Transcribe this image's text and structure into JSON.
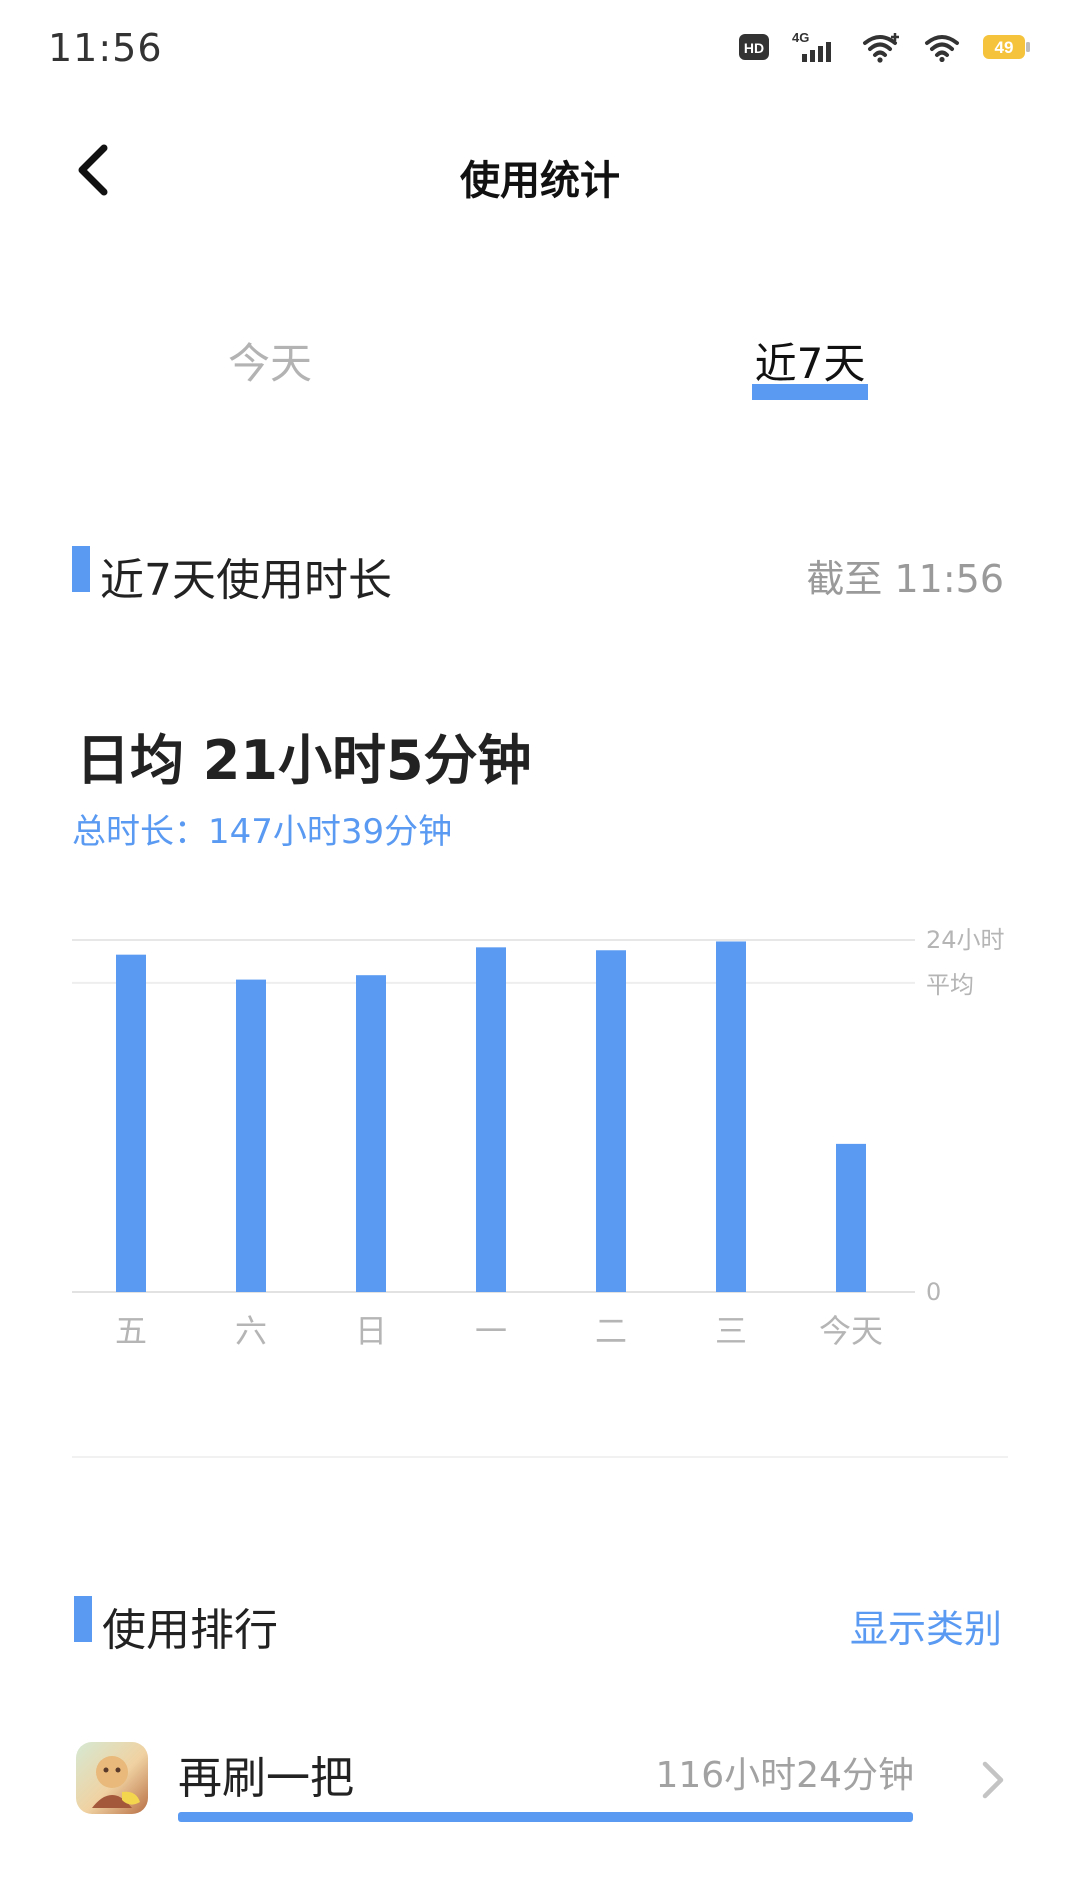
{
  "status_bar": {
    "time": "11:56",
    "hd": "HD",
    "network": "4G",
    "battery": "49"
  },
  "header": {
    "title": "使用统计"
  },
  "tabs": [
    {
      "label": "今天",
      "active": false
    },
    {
      "label": "近7天",
      "active": true
    }
  ],
  "usage_section": {
    "title": "近7天使用时长",
    "as_of": "截至 11:56",
    "daily_average": "日均 21小时5分钟",
    "total": "总时长：147小时39分钟"
  },
  "chart_data": {
    "type": "bar",
    "categories": [
      "五",
      "六",
      "日",
      "一",
      "二",
      "三",
      "今天"
    ],
    "values": [
      23.0,
      21.3,
      21.6,
      23.5,
      23.3,
      23.9,
      10.1
    ],
    "unit": "小时",
    "ylim": [
      0,
      24
    ],
    "max_label": "24小时",
    "avg_label": "平均",
    "average": 21.08,
    "zero_label": "0",
    "bar_color": "#5a9af2"
  },
  "ranking_section": {
    "title": "使用排行",
    "toggle_label": "显示类别",
    "items": [
      {
        "name": "再刷一把",
        "time": "116小时24分钟",
        "hours": 116.4
      }
    ]
  },
  "colors": {
    "accent": "#5a9af2",
    "text_primary": "#222222",
    "text_secondary": "#9a9a9a"
  }
}
